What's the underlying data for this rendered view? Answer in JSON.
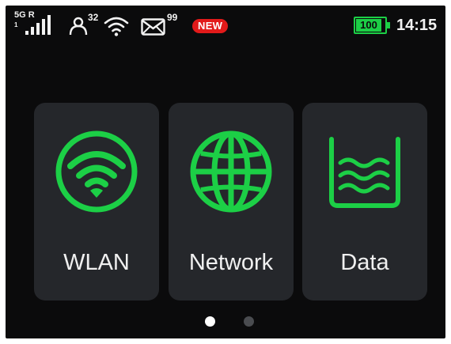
{
  "status_bar": {
    "network_type": "5G R",
    "sim_number": "1",
    "signal_icon": "signal-bars-icon",
    "user_icon": "user-icon",
    "connected_users": "32",
    "wifi_icon": "wifi-icon",
    "mail_icon": "mail-icon",
    "unread_messages": "99",
    "new_badge": "NEW",
    "battery_level": "100",
    "battery_color": "#1ccf46",
    "time": "14:15"
  },
  "tiles": [
    {
      "label": "WLAN",
      "icon": "wifi-circle-icon"
    },
    {
      "label": "Network",
      "icon": "globe-icon"
    },
    {
      "label": "Data",
      "icon": "data-usage-icon"
    }
  ],
  "pager": {
    "pages": 2,
    "current": 1
  },
  "colors": {
    "accent": "#1ccf46",
    "background": "#0b0b0c",
    "tile": "#25272b",
    "badge": "#e21a1a"
  }
}
